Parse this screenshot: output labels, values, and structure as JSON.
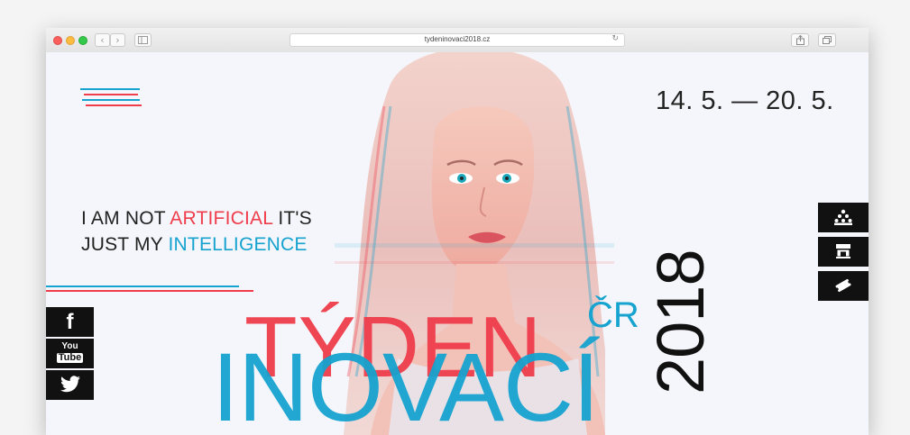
{
  "browser": {
    "url": "tydeninovaci2018.cz",
    "back_glyph": "‹",
    "forward_glyph": "›",
    "reload_glyph": "↻"
  },
  "hero": {
    "date_range": "14. 5. — 20. 5.",
    "tagline": {
      "line1_a": "I AM NOT ",
      "line1_red": "ARTIFICIAL",
      "line1_b": " IT'S",
      "line2_a": "JUST MY ",
      "line2_blue": "INTELLIGENCE"
    },
    "title_word1": "TÝDEN",
    "title_word2": "INOVACÍ",
    "country": "ČR",
    "year": "2018"
  },
  "social": {
    "facebook": "f",
    "youtube_top": "You",
    "youtube_bottom": "Tube"
  },
  "colors": {
    "accent_red": "#ef3d4c",
    "accent_blue": "#16a3cf",
    "dark": "#111111"
  }
}
